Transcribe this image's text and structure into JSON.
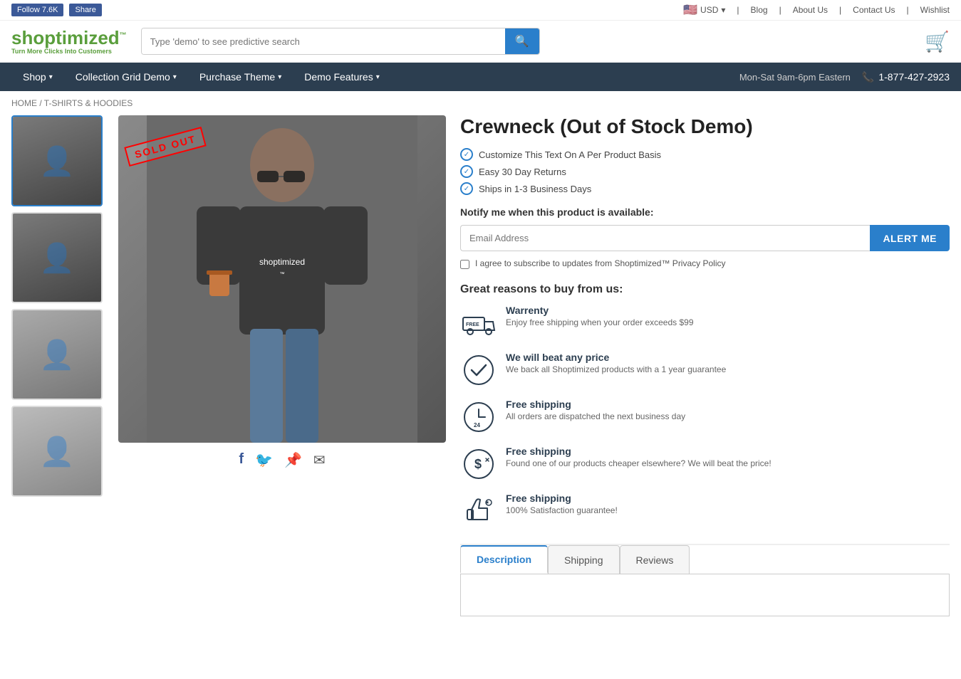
{
  "topbar": {
    "fb_follow_label": "Follow 7.6K",
    "fb_share_label": "Share",
    "currency": "USD",
    "flag_emoji": "🇺🇸",
    "links": [
      "Blog",
      "About Us",
      "Contact Us",
      "Wishlist"
    ]
  },
  "header": {
    "logo_name": "shoptimized",
    "logo_tm": "™",
    "logo_tagline": "Turn More Clicks Into Customers",
    "search_placeholder": "Type 'demo' to see predictive search"
  },
  "nav": {
    "items": [
      {
        "label": "Shop",
        "has_dropdown": true
      },
      {
        "label": "Collection Grid Demo",
        "has_dropdown": true
      },
      {
        "label": "Purchase Theme",
        "has_dropdown": true
      },
      {
        "label": "Demo Features",
        "has_dropdown": true
      }
    ],
    "hours": "Mon-Sat 9am-6pm Eastern",
    "phone": "1-877-427-2923"
  },
  "breadcrumb": {
    "home": "HOME",
    "separator": "/",
    "category": "T-SHIRTS & HOODIES"
  },
  "product": {
    "title": "Crewneck (Out of Stock Demo)",
    "sold_out_badge": "SOLD OUT",
    "features": [
      "Customize This Text On A Per Product Basis",
      "Easy 30 Day Returns",
      "Ships in 1-3 Business Days"
    ],
    "notify_label": "Notify me when this product is available:",
    "email_placeholder": "Email Address",
    "alert_btn_label": "ALERT ME",
    "subscribe_text": "I agree to subscribe to updates from Shoptimized™ Privacy Policy",
    "reasons_title": "Great reasons to buy from us:",
    "reasons": [
      {
        "icon": "🚚",
        "title": "Warrenty",
        "desc": "Enjoy free shipping when your order exceeds $99"
      },
      {
        "icon": "✅",
        "title": "We will beat any price",
        "desc": "We back all Shoptimized products with a 1 year guarantee"
      },
      {
        "icon": "⏰",
        "title": "Free shipping",
        "desc": "All orders are dispatched the next business day"
      },
      {
        "icon": "💲",
        "title": "Free shipping",
        "desc": "Found one of our products cheaper elsewhere? We will beat the price!"
      },
      {
        "icon": "👍",
        "title": "Free shipping",
        "desc": "100% Satisfaction guarantee!"
      }
    ],
    "tabs": [
      "Description",
      "Shipping",
      "Reviews"
    ],
    "active_tab": "Description"
  },
  "social": {
    "icons": [
      "f",
      "t",
      "p",
      "✉"
    ]
  }
}
